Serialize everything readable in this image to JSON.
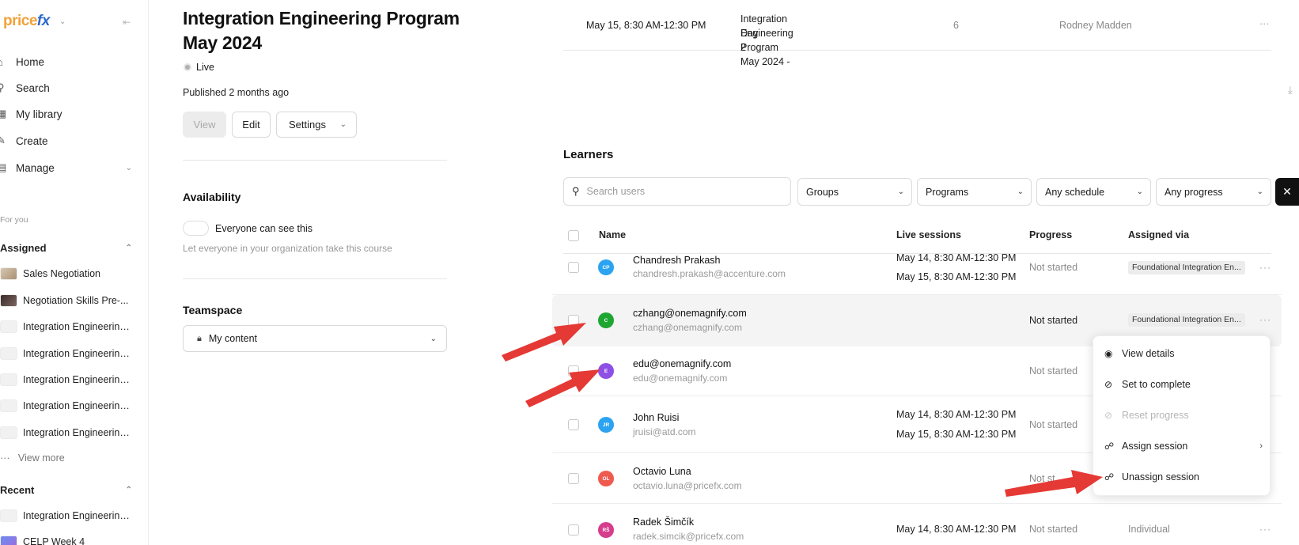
{
  "sidebar": {
    "logo_a": "price",
    "logo_b": "fx",
    "nav": [
      {
        "label": "Home",
        "icon": "home-icon"
      },
      {
        "label": "Search",
        "icon": "search-icon"
      },
      {
        "label": "My library",
        "icon": "library-icon"
      },
      {
        "label": "Create",
        "icon": "create-icon"
      },
      {
        "label": "Manage",
        "icon": "manage-icon"
      }
    ],
    "for_you": "For you",
    "assigned_label": "Assigned",
    "assigned": [
      "Sales Negotiation",
      "Negotiation Skills Pre-...",
      "Integration Engineering...",
      "Integration Engineering...",
      "Integration Engineering...",
      "Integration Engineering...",
      "Integration Engineering..."
    ],
    "view_more": "View more",
    "recent_label": "Recent",
    "recent": [
      "Integration Engineering...",
      "CELP Week 4"
    ]
  },
  "course": {
    "title": "Integration Engineering Program May 2024",
    "status": "Live",
    "published_prefix": "Published ",
    "published_when": "2 months ago",
    "buttons": {
      "view": "View",
      "edit": "Edit",
      "settings": "Settings"
    },
    "availability_heading": "Availability",
    "availability_toggle": "Everyone can see this",
    "availability_note": "Let everyone in your organization take this course",
    "teamspace_heading": "Teamspace",
    "teamspace_value": "My content"
  },
  "session_row": {
    "time": "May 15, 8:30 AM-12:30 PM",
    "name_line1": "Integration Engineering Program May 2024 -",
    "name_line2": "Day 2",
    "count": "6",
    "instructor": "Rodney Madden",
    "more": "···"
  },
  "learners": {
    "title": "Learners",
    "search_placeholder": "Search users",
    "filters": {
      "groups": "Groups",
      "programs": "Programs",
      "schedule": "Any schedule",
      "progress": "Any progress"
    },
    "close": "✕",
    "columns": {
      "name": "Name",
      "sessions": "Live sessions",
      "progress": "Progress",
      "via": "Assigned via"
    },
    "rows": [
      {
        "initials": "CP",
        "name": "Chandresh Prakash",
        "email": "chandresh.prakash@accenture.com",
        "s1": "May 14, 8:30 AM-12:30 PM",
        "s2": "May 15, 8:30 AM-12:30 PM",
        "progress": "Not started",
        "via": "Foundational Integration En...",
        "color": "#2ba3f0"
      },
      {
        "initials": "C",
        "name": "czhang@onemagnify.com",
        "email": "czhang@onemagnify.com",
        "s1": "",
        "s2": "",
        "progress": "Not started",
        "via": "Foundational Integration En...",
        "color": "#1fa632"
      },
      {
        "initials": "E",
        "name": "edu@onemagnify.com",
        "email": "edu@onemagnify.com",
        "s1": "",
        "s2": "",
        "progress": "Not started",
        "via": "",
        "color": "#8e4fe6"
      },
      {
        "initials": "JR",
        "name": "John Ruisi",
        "email": "jruisi@atd.com",
        "s1": "May 14, 8:30 AM-12:30 PM",
        "s2": "May 15, 8:30 AM-12:30 PM",
        "progress": "Not started",
        "via": "",
        "color": "#2ba3f0"
      },
      {
        "initials": "OL",
        "name": "Octavio Luna",
        "email": "octavio.luna@pricefx.com",
        "s1": "",
        "s2": "",
        "progress": "Not st",
        "via": "",
        "color": "#ef5a4f"
      },
      {
        "initials": "RŠ",
        "name": "Radek Šimčík",
        "email": "radek.simcik@pricefx.com",
        "s1": "May 14, 8:30 AM-12:30 PM",
        "s2": "",
        "progress": "Not started",
        "via": "Individual",
        "color": "#d63d8c"
      }
    ],
    "more": "···"
  },
  "menu": {
    "items": [
      {
        "label": "View details",
        "icon": "user-circle-icon"
      },
      {
        "label": "Set to complete",
        "icon": "check-circle-icon"
      },
      {
        "label": "Reset progress",
        "icon": "reset-icon"
      },
      {
        "label": "Assign session",
        "icon": "assign-session-icon"
      },
      {
        "label": "Unassign session",
        "icon": "unassign-session-icon"
      }
    ]
  },
  "colors": {
    "accent_red": "#e53935",
    "logo_orange": "#f2a23a",
    "logo_blue": "#2c6ac9"
  }
}
